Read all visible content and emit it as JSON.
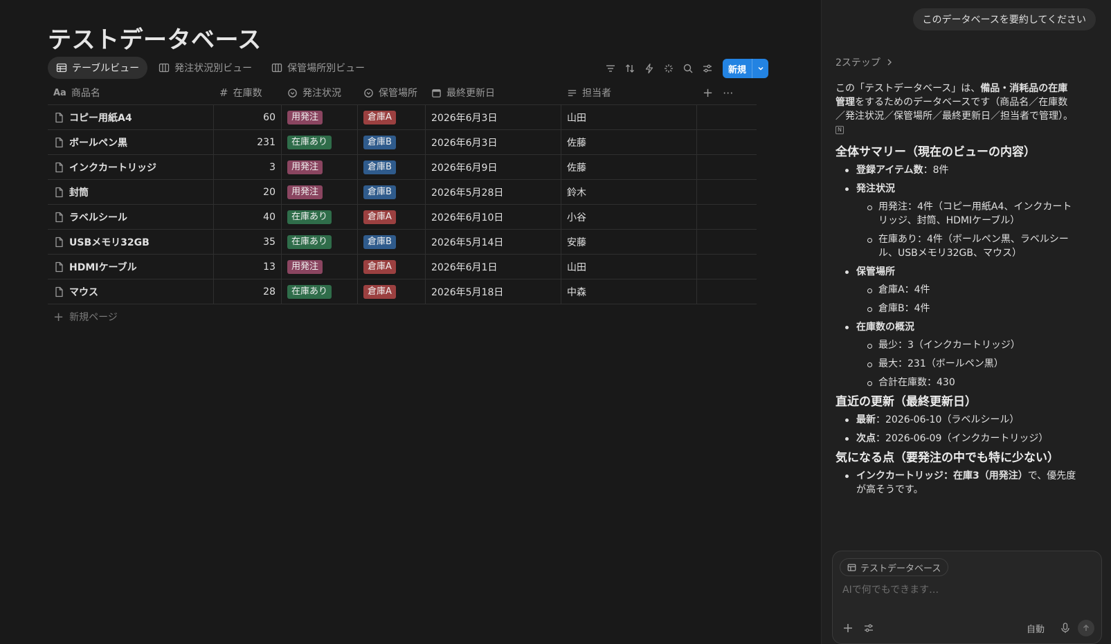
{
  "page": {
    "title": "テストデータベース"
  },
  "views": [
    {
      "label": "テーブルビュー",
      "active": true
    },
    {
      "label": "発注状況別ビュー",
      "active": false
    },
    {
      "label": "保管場所別ビュー",
      "active": false
    }
  ],
  "toolbar": {
    "new_label": "新規"
  },
  "table": {
    "columns": [
      "商品名",
      "在庫数",
      "発注状況",
      "保管場所",
      "最終更新日",
      "担当者"
    ],
    "rows": [
      {
        "name": "コピー用紙A4",
        "qty": "60",
        "status": "用発注",
        "loc": "倉庫A",
        "date": "2026年6月3日",
        "person": "山田"
      },
      {
        "name": "ボールペン黒",
        "qty": "231",
        "status": "在庫あり",
        "loc": "倉庫B",
        "date": "2026年6月3日",
        "person": "佐藤"
      },
      {
        "name": "インクカートリッジ",
        "qty": "3",
        "status": "用発注",
        "loc": "倉庫B",
        "date": "2026年6月9日",
        "person": "佐藤"
      },
      {
        "name": "封筒",
        "qty": "20",
        "status": "用発注",
        "loc": "倉庫B",
        "date": "2026年5月28日",
        "person": "鈴木"
      },
      {
        "name": "ラベルシール",
        "qty": "40",
        "status": "在庫あり",
        "loc": "倉庫A",
        "date": "2026年6月10日",
        "person": "小谷"
      },
      {
        "name": "USBメモリ32GB",
        "qty": "35",
        "status": "在庫あり",
        "loc": "倉庫B",
        "date": "2026年5月14日",
        "person": "安藤"
      },
      {
        "name": "HDMIケーブル",
        "qty": "13",
        "status": "用発注",
        "loc": "倉庫A",
        "date": "2026年6月1日",
        "person": "山田"
      },
      {
        "name": "マウス",
        "qty": "28",
        "status": "在庫あり",
        "loc": "倉庫A",
        "date": "2026年5月18日",
        "person": "中森"
      }
    ],
    "add_row_label": "新規ページ"
  },
  "colors": {
    "用発注": "#8a4560",
    "在庫あり": "#2f6d4a",
    "倉庫A": "#9b4040",
    "倉庫B": "#2f5b8c",
    "accent": "#2383e2"
  },
  "sidebar": {
    "user_message": "このデータベースを要約してください",
    "steps_label": "2ステップ",
    "intro_a": "この「テストデータベース」は、",
    "intro_b": "備品・消耗品の在庫管理",
    "intro_c": "をするためのデータベースです（商品名／在庫数／発注状況／保管場所／最終更新日／担当者で管理）。",
    "h_summary": "全体サマリー（現在のビューの内容）",
    "count_label": "登録アイテム数",
    "count_value": "：8件",
    "status_label": "発注状況",
    "status_1": "用発注：4件（コピー用紙A4、インクカートリッジ、封筒、HDMIケーブル）",
    "status_2": "在庫あり：4件（ボールペン黒、ラベルシール、USBメモリ32GB、マウス）",
    "loc_label": "保管場所",
    "loc_1": "倉庫A：4件",
    "loc_2": "倉庫B：4件",
    "stock_label": "在庫数の概況",
    "stock_1": "最少：3（インクカートリッジ）",
    "stock_2": "最大：231（ボールペン黒）",
    "stock_3": "合計在庫数：430",
    "h_recent": "直近の更新（最終更新日）",
    "recent_1_label": "最新",
    "recent_1_value": "：2026-06-10（ラベルシール）",
    "recent_2_label": "次点",
    "recent_2_value": "：2026-06-09（インクカートリッジ）",
    "h_concern": "気になる点（要発注の中でも特に少ない）",
    "concern_bold": "インクカートリッジ：在庫3（用発注）",
    "concern_rest": "で、優先度が高そうです。",
    "context_chip": "テストデータベース",
    "input_placeholder": "AIで何でもできます…",
    "mode_label": "自動"
  }
}
